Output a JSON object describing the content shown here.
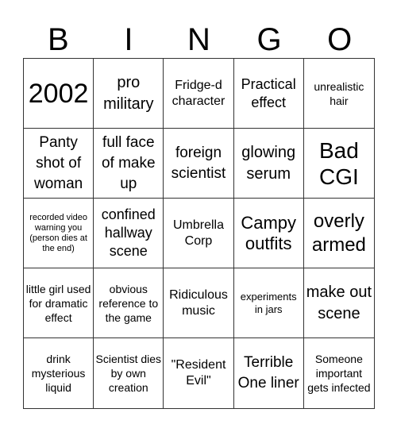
{
  "header": [
    "B",
    "I",
    "N",
    "G",
    "O"
  ],
  "cells": [
    "2002",
    "pro military",
    "Fridge-d character",
    "Practical effect",
    "unrealistic hair",
    "Panty shot of woman",
    "full face of make up",
    "foreign scientist",
    "glowing serum",
    "Bad CGI",
    "recorded video warning you (person dies at the end)",
    "confined hallway scene",
    "Umbrella Corp",
    "Campy outfits",
    "overly armed",
    "little girl used for dramatic effect",
    "obvious reference to the game",
    "Ridiculous music",
    "experiments in jars",
    "make out scene",
    "drink mysterious liquid",
    "Scientist dies by own creation",
    "\"Resident Evil\"",
    "Terrible One liner",
    "Someone important gets infected"
  ]
}
